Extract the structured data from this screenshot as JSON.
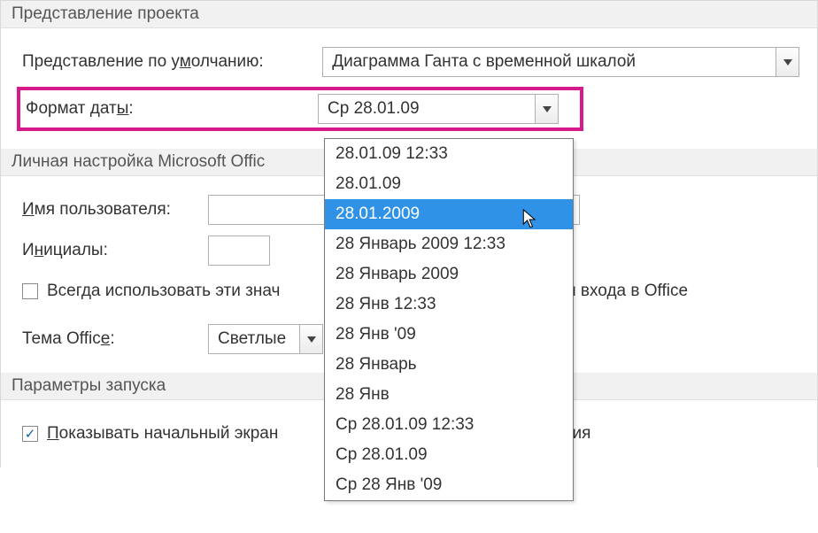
{
  "sections": {
    "project_view": {
      "title": "Представление проекта",
      "default_view_label": "Представление по умолчанию:",
      "default_view_value": "Диаграмма Ганта с временной шкалой",
      "date_format_label": "Формат даты:",
      "date_format_value": "Ср 28.01.09"
    },
    "personal": {
      "title": "Личная настройка Microsoft Offic",
      "username_label": "Имя пользователя:",
      "initials_label": "Инициалы:",
      "always_use_label_part1": "Всегда использовать эти знач",
      "always_use_label_part2": "ояния входа в Office",
      "theme_label": "Тема Office:",
      "theme_value": "Светлые"
    },
    "startup": {
      "title": "Параметры запуска",
      "show_start_label_part1": "Показывать начальный экран",
      "show_start_label_part2": "ожения",
      "show_start_checked": true
    }
  },
  "date_format_options": [
    "28.01.09 12:33",
    "28.01.09",
    "28.01.2009",
    "28 Январь 2009 12:33",
    "28 Январь 2009",
    "28 Янв 12:33",
    "28 Янв '09",
    "28 Январь",
    "28 Янв",
    "Ср 28.01.09 12:33",
    "Ср 28.01.09",
    "Ср 28 Янв '09"
  ],
  "date_format_selected_index": 2
}
